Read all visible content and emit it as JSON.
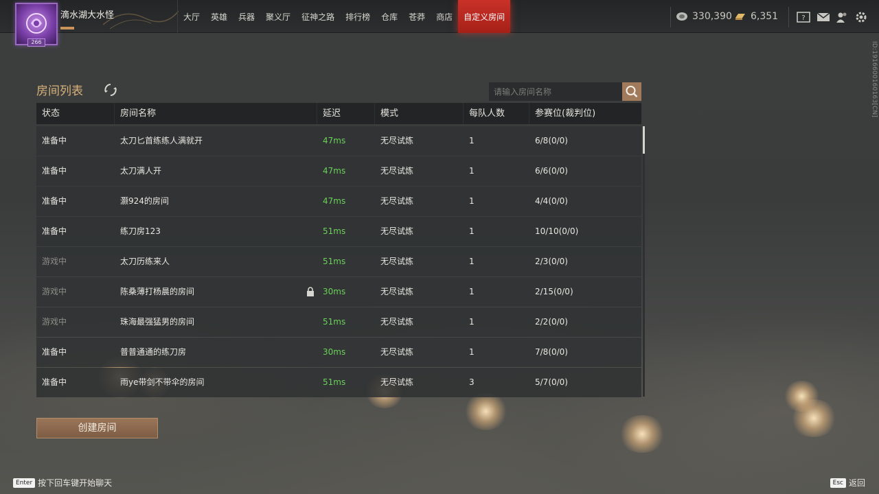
{
  "player": {
    "name": "滴水湖大水怪",
    "level": "266"
  },
  "nav": {
    "items": [
      "大厅",
      "英雄",
      "兵器",
      "聚义厅",
      "征神之路",
      "排行榜",
      "仓库",
      "苍莽",
      "商店",
      "自定义房间"
    ],
    "active_index": 9
  },
  "currency": {
    "silver": "330,390",
    "gold": "6,351"
  },
  "side_id": "ID:1916600160163[CN]",
  "room_list": {
    "title": "房间列表",
    "search_placeholder": "请输入房间名称",
    "columns": [
      "状态",
      "房间名称",
      "延迟",
      "模式",
      "每队人数",
      "参赛位(裁判位)"
    ],
    "rows": [
      {
        "status": "准备中",
        "name": "太刀匕首练练人满就开",
        "ping": "47ms",
        "mode": "无尽试炼",
        "team_size": "1",
        "slots": "6/8(0/0)",
        "locked": false,
        "playing": false
      },
      {
        "status": "准备中",
        "name": "太刀满人开",
        "ping": "47ms",
        "mode": "无尽试炼",
        "team_size": "1",
        "slots": "6/6(0/0)",
        "locked": false,
        "playing": false
      },
      {
        "status": "准备中",
        "name": "灏924的房间",
        "ping": "47ms",
        "mode": "无尽试炼",
        "team_size": "1",
        "slots": "4/4(0/0)",
        "locked": false,
        "playing": false
      },
      {
        "status": "准备中",
        "name": "练刀房123",
        "ping": "51ms",
        "mode": "无尽试炼",
        "team_size": "1",
        "slots": "10/10(0/0)",
        "locked": false,
        "playing": false
      },
      {
        "status": "游戏中",
        "name": "太刀历练来人",
        "ping": "51ms",
        "mode": "无尽试炼",
        "team_size": "1",
        "slots": "2/3(0/0)",
        "locked": false,
        "playing": true
      },
      {
        "status": "游戏中",
        "name": "陈桑薄打杨晨的房间",
        "ping": "30ms",
        "mode": "无尽试炼",
        "team_size": "1",
        "slots": "2/15(0/0)",
        "locked": true,
        "playing": true
      },
      {
        "status": "游戏中",
        "name": "珠海最强猛男的房间",
        "ping": "51ms",
        "mode": "无尽试炼",
        "team_size": "1",
        "slots": "2/2(0/0)",
        "locked": false,
        "playing": true
      },
      {
        "status": "准备中",
        "name": "普普通通的练刀房",
        "ping": "30ms",
        "mode": "无尽试炼",
        "team_size": "1",
        "slots": "7/8(0/0)",
        "locked": false,
        "playing": false
      },
      {
        "status": "准备中",
        "name": "雨ye带剑不带伞的房间",
        "ping": "51ms",
        "mode": "无尽试炼",
        "team_size": "3",
        "slots": "5/7(0/0)",
        "locked": false,
        "playing": false
      }
    ],
    "create_button": "创建房间"
  },
  "footer": {
    "chat_key": "Enter",
    "chat_hint": "按下回车键开始聊天",
    "back_key": "Esc",
    "back_label": "返回"
  },
  "colors": {
    "accent_gold": "#d8b27a",
    "active_tab": "#c93128",
    "ping_green": "#6bd35a",
    "create_button": "#9a7558"
  }
}
